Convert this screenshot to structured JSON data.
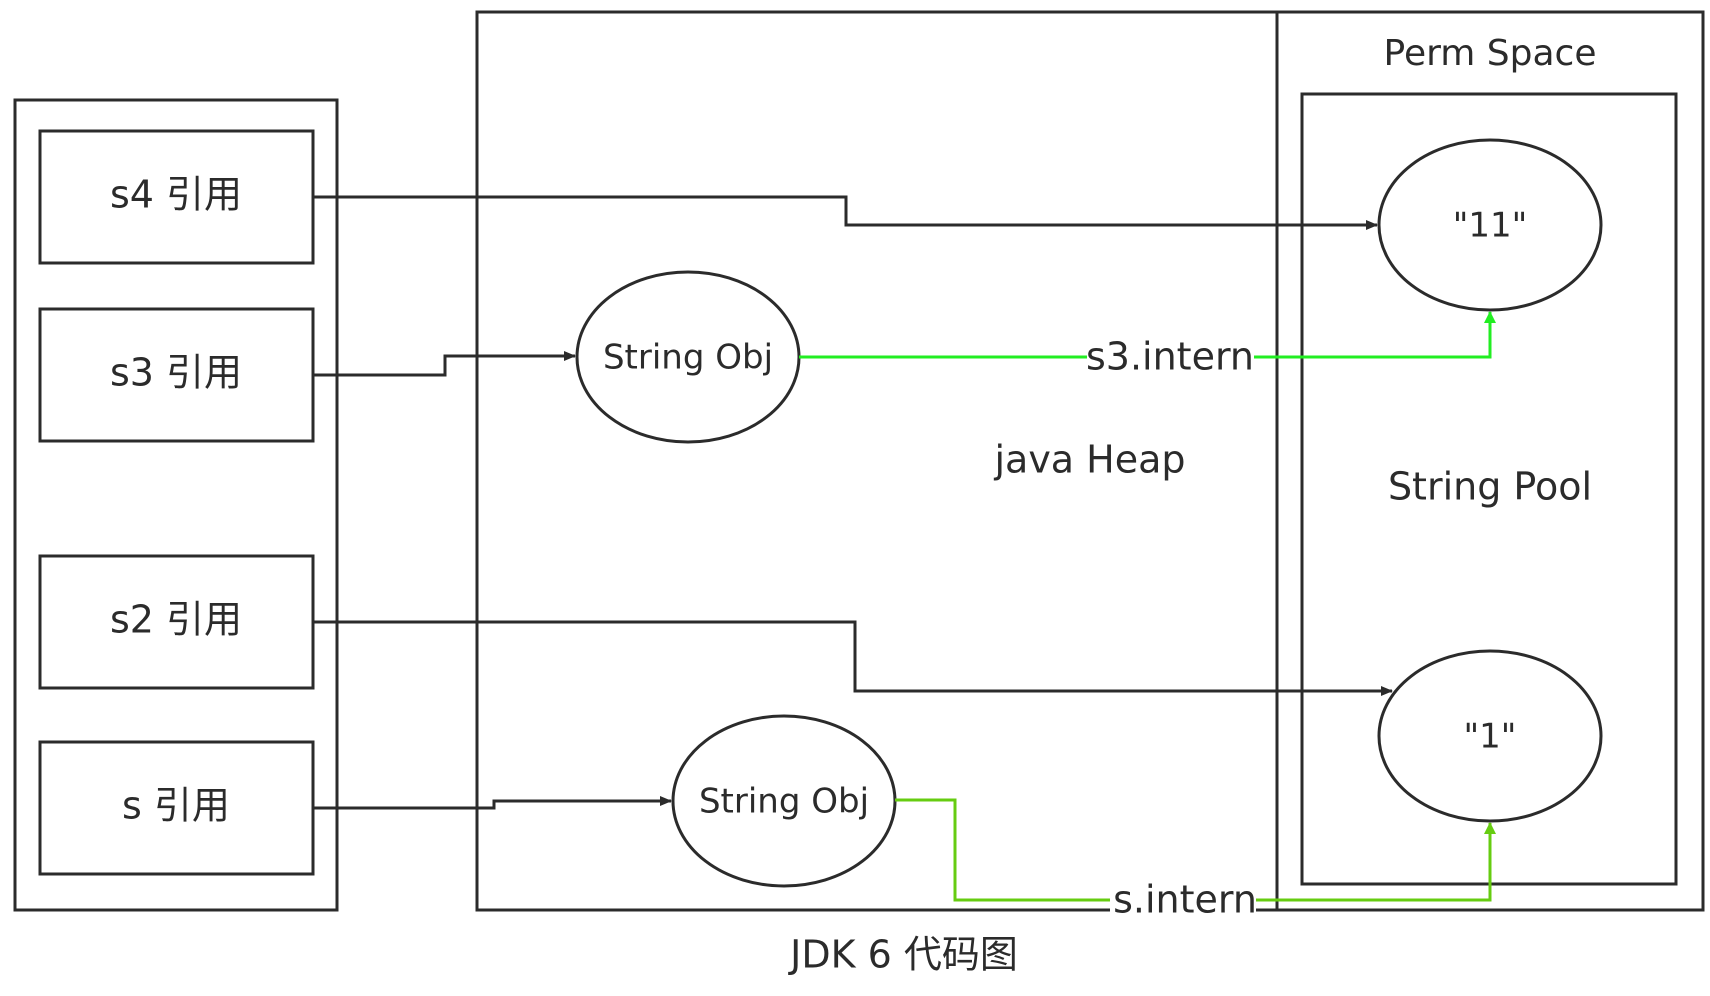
{
  "stack_refs": {
    "s4": "s4 引用",
    "s3": "s3 引用",
    "s2": "s2 引用",
    "s": "s 引用"
  },
  "heap": {
    "label": "java Heap",
    "obj_upper": "String Obj",
    "obj_lower": "String Obj"
  },
  "perm": {
    "title": "Perm Space",
    "pool_label": "String Pool",
    "lit_11": "\"11\"",
    "lit_1": "\"1\""
  },
  "edges": {
    "s3_intern": "s3.intern",
    "s_intern": "s.intern"
  },
  "caption": "JDK 6 代码图",
  "colors": {
    "stroke": "#2b2b2b",
    "intern_upper": "#22ee22",
    "intern_lower": "#66cc11",
    "background": "#ffffff"
  }
}
